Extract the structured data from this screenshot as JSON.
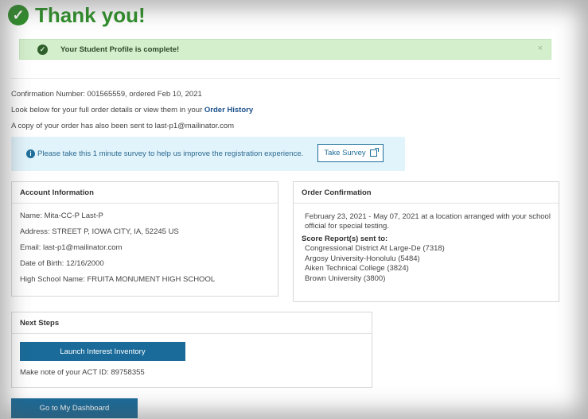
{
  "title": "Thank you!",
  "banner": {
    "message": "Your Student Profile is complete!",
    "close_glyph": "×"
  },
  "confirmation_line": "Confirmation Number: 001565559, ordered Feb 10, 2021",
  "order_details_prefix": "Look below for your full order details or view them in your ",
  "order_history_link": "Order History",
  "email_copy_line": "A copy of your order has also been sent to last-p1@mailinator.com",
  "survey": {
    "text": "Please take this 1 minute survey to help us improve the registration experience.",
    "button_label": "Take Survey"
  },
  "account": {
    "heading": "Account Information",
    "rows": [
      "Name: Mita-CC-P Last-P",
      "Address: STREET P, IOWA CITY, IA, 52245 US",
      "Email: last-p1@mailinator.com",
      "Date of Birth: 12/16/2000",
      "High School Name: FRUITA MONUMENT HIGH SCHOOL"
    ]
  },
  "order": {
    "heading": "Order Confirmation",
    "testing_line1": "February 23, 2021 - May 07, 2021 at a location arranged with your school",
    "testing_line2": "official for special testing.",
    "score_heading": "Score Report(s) sent to:",
    "score_reports": [
      "Congressional District At Large-De (7318)",
      "Argosy University-Honolulu (5484)",
      "Aiken Technical College (3824)",
      "Brown University (3800)"
    ]
  },
  "next_steps": {
    "heading": "Next Steps",
    "launch_button": "Launch Interest Inventory",
    "act_id_line": "Make note of your ACT ID: 89758355"
  },
  "dashboard_button": "Go to My Dashboard",
  "colors": {
    "success_green": "#2f8f2a",
    "banner_bg": "#d3efcc",
    "primary_blue": "#1a6b9a",
    "info_bg": "#e1f3fb"
  }
}
